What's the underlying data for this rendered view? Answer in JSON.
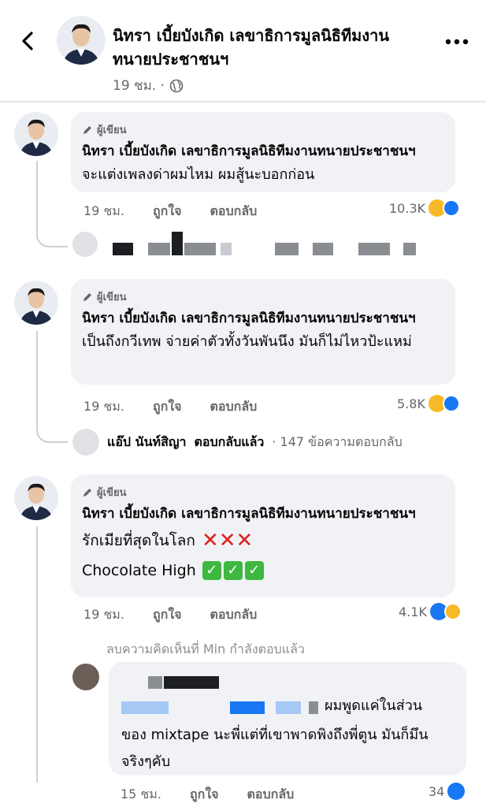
{
  "header": {
    "name": "นิทรา เบี้ยบังเกิด เลขาธิการมูลนิธิทีมงานทนายประชาชนฯ",
    "time": "19 ชม. ·",
    "back_icon": "back-arrow-icon",
    "more_icon": "more-horizontal-icon",
    "globe_icon": "globe-icon"
  },
  "comments": [
    {
      "badge": "ผู้เขียน",
      "name": "นิทรา เบี้ยบังเกิด เลขาธิการมูลนิธิทีมงานทนายประชาชนฯ",
      "text": "จะแต่งเพลงด่าผมไหม ผมสู้นะบอกก่อน",
      "time": "19 ชม.",
      "like": "ถูกใจ",
      "reply": "ตอบกลับ",
      "reactions": "10.3K"
    },
    {
      "badge": "ผู้เขียน",
      "name": "นิทรา เบี้ยบังเกิด เลขาธิการมูลนิธิทีมงานทนายประชาชนฯ",
      "text": "เป็นถึงกวีเทพ จ่ายค่าตัวทั้งวันพันนึง มันก็ไม่ไหวป้ะแหม่",
      "time": "19 ชม.",
      "like": "ถูกใจ",
      "reply": "ตอบกลับ",
      "reactions": "5.8K",
      "reply_summary": {
        "name": "แอ๊ป นันท์สิญา",
        "action": "ตอบกลับแล้ว",
        "count": "· 147 ข้อความตอบกลับ"
      }
    },
    {
      "badge": "ผู้เขียน",
      "name": "นิทรา เบี้ยบังเกิด เลขาธิการมูลนิธิทีมงานทนายประชาชนฯ",
      "line1": "รักเมียที่สุดในโลก",
      "line2": "Chocolate High",
      "time": "19 ชม.",
      "like": "ถูกใจ",
      "reply": "ตอบกลับ",
      "reactions": "4.1K"
    }
  ],
  "deleted_note": "ลบความคิดเห็นที่ Min กำลังตอบแล้ว",
  "nested_reply": {
    "text_tail": "ผมพูดแค่ในส่วน",
    "text_rest": "ของ mixtape นะพี่แต่ที่เขาพาดพิงถึงพี่ตูน มันก็มึนจริงๆคับ",
    "time": "15 ชม.",
    "like": "ถูกใจ",
    "reply": "ตอบกลับ",
    "reactions": "34"
  },
  "colors": {
    "accent": "#1877f2",
    "bubble": "#f0f2f5",
    "muted": "#65676b"
  }
}
